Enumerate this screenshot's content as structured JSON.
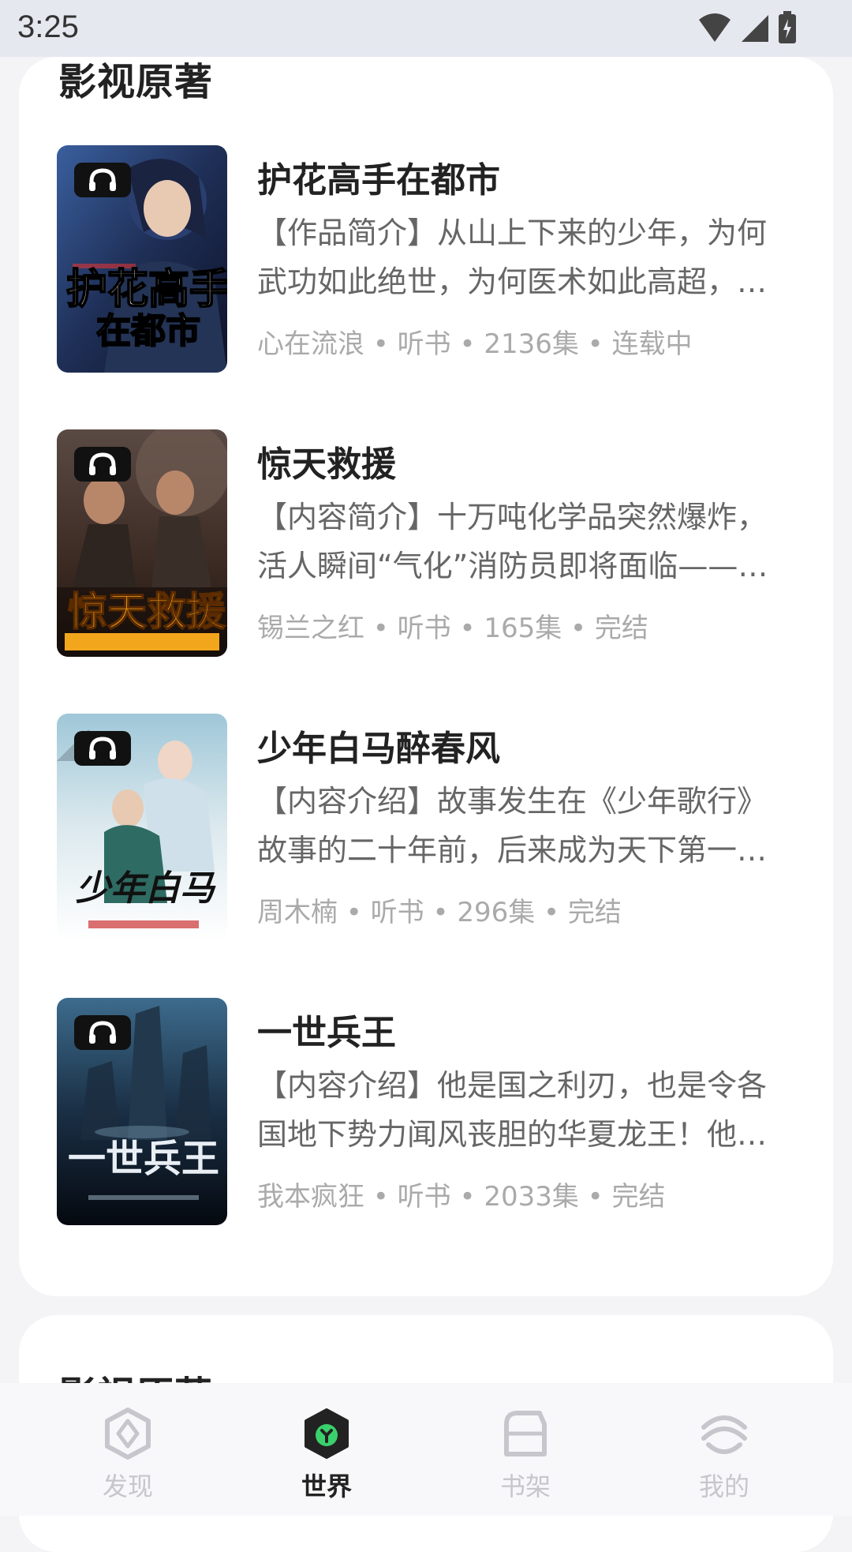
{
  "status_bar": {
    "time": "3:25"
  },
  "section": {
    "title": "影视原著"
  },
  "books": [
    {
      "title": "护花高手在都市",
      "description": "【作品简介】从山上下来的少年，为何武功如此绝世，为何医术如此高超，…",
      "meta": "心在流浪 • 听书 • 2136集 • 连载中",
      "cover_text": "护花高手在都市"
    },
    {
      "title": "惊天救援",
      "description": "【内容简介】十万吨化学品突然爆炸，活人瞬间“气化”消防员即将面临——『…",
      "meta": "锡兰之红 • 听书 • 165集 • 完结",
      "cover_text": "惊天救援"
    },
    {
      "title": "少年白马醉春风",
      "description": "【内容介绍】故事发生在《少年歌行》故事的二十年前，后来成为天下第一…",
      "meta": "周木楠 • 听书 • 296集 • 完结",
      "cover_text": "少年白马"
    },
    {
      "title": "一世兵王",
      "description": "【内容介绍】他是国之利刃，也是令各国地下势力闻风丧胆的华夏龙王！他…",
      "meta": "我本疯狂 • 听书 • 2033集 • 完结",
      "cover_text": "一世兵王"
    }
  ],
  "section2": {
    "title": "影视原著"
  },
  "tabs": [
    {
      "label": "发现",
      "icon": "discover-icon",
      "active": false
    },
    {
      "label": "世界",
      "icon": "world-icon",
      "active": true
    },
    {
      "label": "书架",
      "icon": "bookshelf-icon",
      "active": false
    },
    {
      "label": "我的",
      "icon": "profile-icon",
      "active": false
    }
  ],
  "colors": {
    "accent": "#3ad06b",
    "card": "#ffffff",
    "background": "#f4f4f7"
  }
}
